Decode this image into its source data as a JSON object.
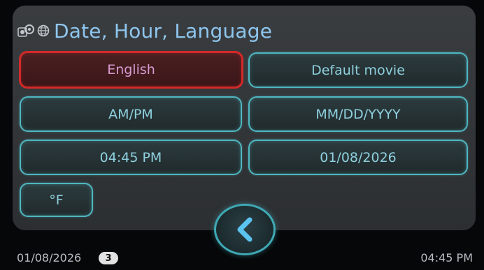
{
  "header": {
    "title": "Date, Hour, Language",
    "icons": [
      "settings-gears-icon",
      "globe-icon"
    ]
  },
  "buttons": {
    "language": "English",
    "default_movie": "Default movie",
    "time_format": "AM/PM",
    "date_format": "MM/DD/YYYY",
    "time_value": "04:45 PM",
    "date_value": "01/08/2026",
    "temperature_unit": "°F"
  },
  "selected_button": "language",
  "back_button": {
    "icon": "chevron-left-icon"
  },
  "footer": {
    "date": "01/08/2026",
    "badge": "3",
    "time": "04:45 PM"
  },
  "colors": {
    "accent": "#4fb7c0",
    "title": "#8ec6ee",
    "selected_border": "#d42929"
  }
}
